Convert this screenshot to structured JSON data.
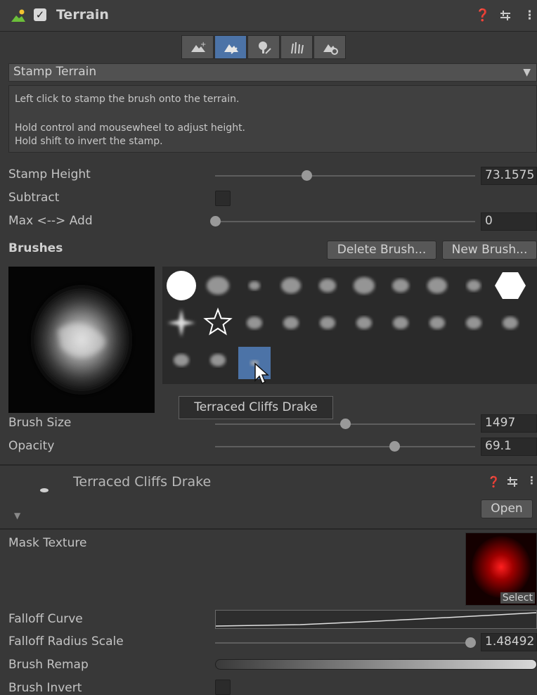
{
  "header": {
    "title": "Terrain",
    "help_icon": "help-icon",
    "preset_icon": "preset-icon",
    "menu_icon": "more-icon"
  },
  "toolbar": {
    "tools": [
      "create-neighbor-icon",
      "paint-terrain-icon",
      "paint-trees-icon",
      "paint-details-icon",
      "terrain-settings-icon"
    ],
    "active_index": 1
  },
  "tool_dropdown": {
    "selected": "Stamp Terrain"
  },
  "help_text": {
    "line1": "Left click to stamp the brush onto the terrain.",
    "line2": "Hold control and mousewheel to adjust height.",
    "line3": "Hold shift to invert the stamp."
  },
  "stamp": {
    "height_label": "Stamp Height",
    "height_value": "73.1575",
    "height_fraction": 0.35,
    "subtract_label": "Subtract",
    "subtract_checked": false,
    "maxadd_label": "Max <--> Add",
    "maxadd_value": "0",
    "maxadd_fraction": 0.0
  },
  "brushes": {
    "label": "Brushes",
    "delete_label": "Delete Brush...",
    "new_label": "New Brush...",
    "selected_index": 22,
    "count": 23,
    "tooltip": "Terraced Cliffs Drake"
  },
  "brush_settings": {
    "size_label": "Brush Size",
    "size_value": "1497",
    "size_fraction": 0.5,
    "opacity_label": "Opacity",
    "opacity_value": "69.1",
    "opacity_fraction": 0.69
  },
  "brush_asset": {
    "name": "Terraced Cliffs Drake",
    "open_label": "Open",
    "mask_label": "Mask Texture",
    "select_label": "Select",
    "falloff_curve_label": "Falloff Curve",
    "falloff_radius_label": "Falloff Radius Scale",
    "falloff_radius_value": "1.48492",
    "falloff_radius_fraction": 0.98,
    "remap_label": "Brush Remap",
    "invert_label": "Brush Invert",
    "invert_checked": false
  },
  "colors": {
    "accent": "#4c73a7",
    "panel": "#383838",
    "field": "#2a2a2a"
  }
}
